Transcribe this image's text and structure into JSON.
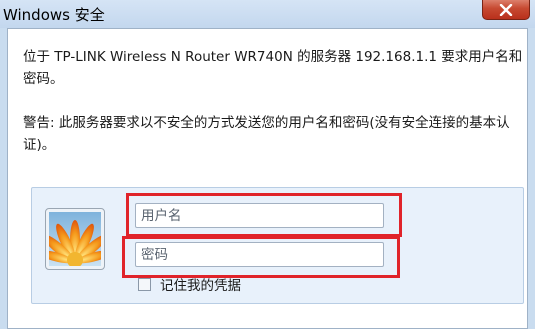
{
  "window": {
    "title": "Windows 安全",
    "close_icon": "close-icon"
  },
  "dialog": {
    "description": "位于 TP-LINK Wireless N Router WR740N 的服务器 192.168.1.1 要求用户名和密码。",
    "warning": "警告: 此服务器要求以不安全的方式发送您的用户名和密码(没有安全连接的基本认证)。"
  },
  "credentials": {
    "avatar_icon": "user-avatar-flower-icon",
    "username_placeholder": "用户名",
    "password_placeholder": "密码",
    "remember_label": "记住我的凭据",
    "remember_checked": false,
    "highlight_color": "#e0232a"
  }
}
